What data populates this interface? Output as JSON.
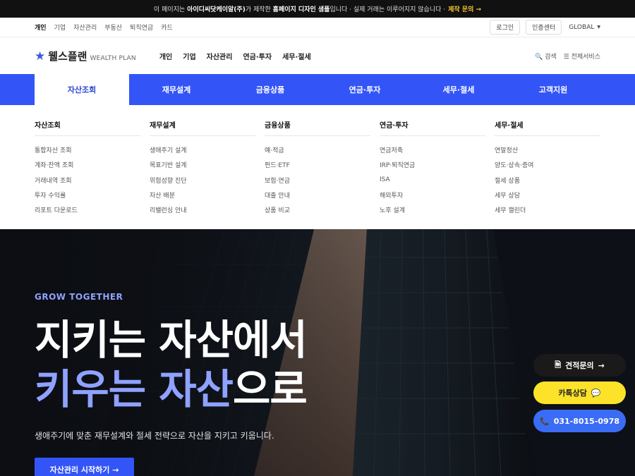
{
  "notice": {
    "prefix": "이 페이지는",
    "company": "아이디씨닷케이알(주)",
    "middle": "가 제작한",
    "sample": "홈페이지 디자인 샘플",
    "suffix": "입니다 · 실제 거래는 이루어지지 않습니다 ·",
    "link": "제작 문의 →"
  },
  "util": {
    "left_items": [
      "개인",
      "기업",
      "자산관리",
      "부동산",
      "퇴직연금",
      "카드"
    ],
    "login": "로그인",
    "cert": "인증센터",
    "global": "GLOBAL",
    "caret": "▼"
  },
  "header": {
    "logo_star": "★",
    "logo_name": "웰스플랜",
    "logo_sub": "WEALTH PLAN",
    "gnb": [
      "개인",
      "기업",
      "자산관리",
      "연금·투자",
      "세무·절세"
    ],
    "search_icon": "🔍",
    "search": "검색",
    "menu_icon": "☰",
    "all_services": "전체서비스"
  },
  "menubar": {
    "items": [
      "자산조회",
      "재무설계",
      "금융상품",
      "연금·투자",
      "세무·절세",
      "고객지원"
    ]
  },
  "mega": {
    "columns": [
      {
        "title": "자산조회",
        "items": [
          "통합자산 조회",
          "계좌·잔액 조회",
          "거래내역 조회",
          "투자 수익률",
          "리포트 다운로드"
        ]
      },
      {
        "title": "재무설계",
        "items": [
          "생애주기 설계",
          "목표기반 설계",
          "위험성향 진단",
          "자산 배분",
          "리밸런싱 안내"
        ]
      },
      {
        "title": "금융상품",
        "items": [
          "예·적금",
          "펀드·ETF",
          "보험·연금",
          "대출 안내",
          "상품 비교"
        ]
      },
      {
        "title": "연금·투자",
        "items": [
          "연금저축",
          "IRP·퇴직연금",
          "ISA",
          "해외투자",
          "노후 설계"
        ]
      },
      {
        "title": "세무·절세",
        "items": [
          "연말정산",
          "양도·상속·증여",
          "절세 상품",
          "세무 상담",
          "세무 캘린더"
        ]
      }
    ]
  },
  "hero": {
    "tag": "GROW TOGETHER",
    "line1": "지키는 자산에서",
    "line2_accent": "키우는 자산",
    "line2_rest": "으로",
    "desc": "생애주기에 맞춘 재무설계와 절세 전략으로 자산을 지키고 키웁니다.",
    "cta": "자산관리 시작하기 →"
  },
  "floating": {
    "quote_icon": "🗎",
    "quote": "견적문의",
    "quote_arrow": "→",
    "kakao": "카톡상담",
    "kakao_icon": "💬",
    "phone_icon": "📞",
    "phone": "031-8015-0978"
  },
  "colors": {
    "brand_blue": "#3355f7",
    "accent_light": "#8fa2ff",
    "kakao_yellow": "#fde22a",
    "phone_blue": "#3b6cf6",
    "notice_highlight": "#f4c430"
  }
}
